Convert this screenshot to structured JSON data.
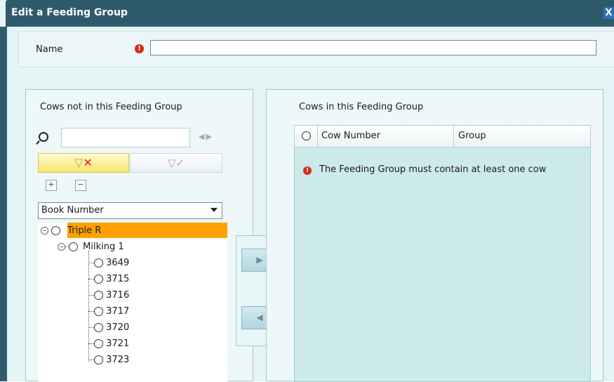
{
  "window": {
    "title": "Edit a Feeding Group",
    "close_label": "X"
  },
  "name_field": {
    "label": "Name",
    "value": "",
    "required_icon": "exclamation-icon"
  },
  "left_panel": {
    "title": "Cows not in this Feeding Group",
    "search": {
      "value": "",
      "icon": "search-icon"
    },
    "filter_tabs": [
      {
        "icon": "funnel-x-icon",
        "active": true
      },
      {
        "icon": "funnel-check-icon",
        "active": false
      }
    ],
    "group_by": {
      "selected": "Book Number"
    },
    "tree": {
      "root": {
        "label": "Triple R",
        "expanded": true,
        "highlight_color": "#ffa200"
      },
      "group": {
        "label": "Milking 1",
        "expanded": true
      },
      "cows": [
        "3649",
        "3715",
        "3716",
        "3717",
        "3720",
        "3721",
        "3723"
      ]
    }
  },
  "move_buttons": {
    "add_icon": "arrow-right-icon",
    "remove_icon": "arrow-left-icon"
  },
  "right_panel": {
    "title": "Cows in this Feeding Group",
    "columns": [
      "Cow Number",
      "Group"
    ],
    "rows": [],
    "validation_message": "The Feeding Group must contain at least one cow"
  },
  "colors": {
    "titlebar": "#2f5a6c",
    "panel_bg": "#e4f3f5",
    "grid_bg": "#cdeaea",
    "highlight": "#ffa200",
    "error": "#d42a14"
  }
}
